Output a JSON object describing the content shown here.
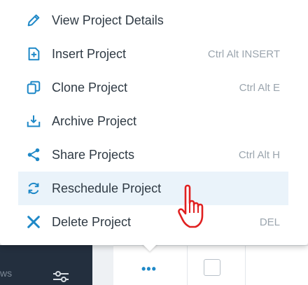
{
  "menu": {
    "items": [
      {
        "label": "View Project Details",
        "shortcut": "",
        "icon": "pencil-icon"
      },
      {
        "label": "Insert Project",
        "shortcut": "Ctrl Alt INSERT",
        "icon": "insert-icon"
      },
      {
        "label": "Clone Project",
        "shortcut": "Ctrl Alt E",
        "icon": "clone-icon"
      },
      {
        "label": "Archive Project",
        "shortcut": "",
        "icon": "archive-icon"
      },
      {
        "label": "Share Projects",
        "shortcut": "Ctrl Alt H",
        "icon": "share-icon"
      },
      {
        "label": "Reschedule Project",
        "shortcut": "",
        "icon": "reschedule-icon",
        "active": true
      },
      {
        "label": "Delete Project",
        "shortcut": "DEL",
        "icon": "delete-icon"
      }
    ]
  },
  "background": {
    "sidebar_text": "ws",
    "more_label": "•••"
  },
  "colors": {
    "accent": "#1e88c7",
    "sidebar": "#232f3e",
    "active_row": "#eaf3fa",
    "cursor": "#e02020"
  }
}
